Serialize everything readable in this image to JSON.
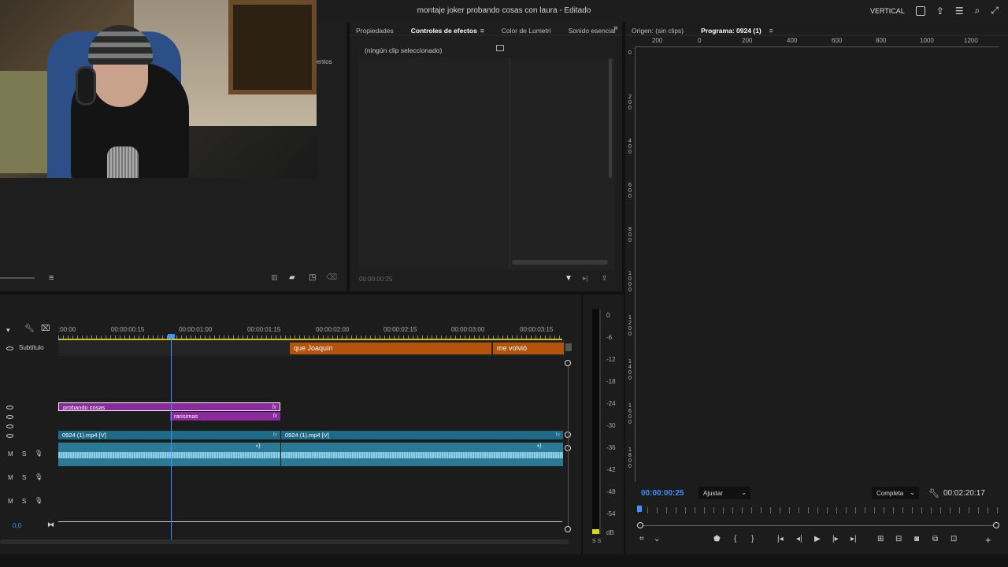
{
  "app": {
    "title": "montaje joker probando cosas con laura - Editado",
    "workspace": "VERTICAL"
  },
  "left_panel": {
    "partial_text": "entos"
  },
  "effect_panel": {
    "tabs": [
      "Propiedades",
      "Controles de efectos",
      "Color de Lumetri",
      "Sonido esencial"
    ],
    "active_tab": "Controles de efectos",
    "no_clip": "(ningún clip seleccionado)",
    "timecode": "00:00:00:25"
  },
  "program_monitor": {
    "tabs": [
      "Origen: (sin clips)",
      "Programa: 0924 (1)"
    ],
    "ruler_labels": [
      "200",
      "0",
      "200",
      "400",
      "600",
      "800",
      "1000",
      "1200"
    ],
    "vruler_labels": [
      "0",
      "2\n0\n0",
      "4\n0\n0",
      "6\n0\n0",
      "8\n0\n0",
      "1\n0\n0\n0",
      "1\n2\n0\n0",
      "1\n4\n0\n0",
      "1\n6\n0\n0",
      "1\n8\n0\n0"
    ],
    "current_time": "00:00:00:25",
    "fit_option": "Ajustar",
    "quality": "Completa",
    "duration": "00:02:20:17"
  },
  "timeline": {
    "ruler_labels": [
      ":00:00",
      "00:00:00:15",
      "00:00:01:00",
      "00:00:01:15",
      "00:00:02:00",
      "00:00:02:15",
      "00:00:03:00",
      "00:00:03:15"
    ],
    "subtitle_track_label": "Subtítulo",
    "subtitle_clips": [
      {
        "text": "que Joaquín"
      },
      {
        "text": "me volvió"
      }
    ],
    "video_clips": [
      {
        "text": "probando cosas",
        "fx": "fx"
      },
      {
        "text": "rarisimas",
        "fx": "fx"
      },
      {
        "text": "0924 (1).mp4 [V]",
        "fx": "fx"
      },
      {
        "text": "0924 (1).mp4 [V]",
        "fx": "fx"
      }
    ],
    "audio_controls": {
      "m": "M",
      "s": "S"
    },
    "volume_value": "0,0"
  },
  "meter": {
    "labels": [
      "0",
      "-6",
      "-12",
      "-18",
      "-24",
      "-30",
      "-36",
      "-42",
      "-48",
      "-54",
      "dB"
    ],
    "bottom_labels": "S S"
  },
  "colors": {
    "accent": "#2d8ceb",
    "subtitle_clip": "#b3530c",
    "graphic_clip": "#8a2a9e",
    "video_clip": "#1f6a87",
    "audio_clip": "#2a7a96"
  }
}
